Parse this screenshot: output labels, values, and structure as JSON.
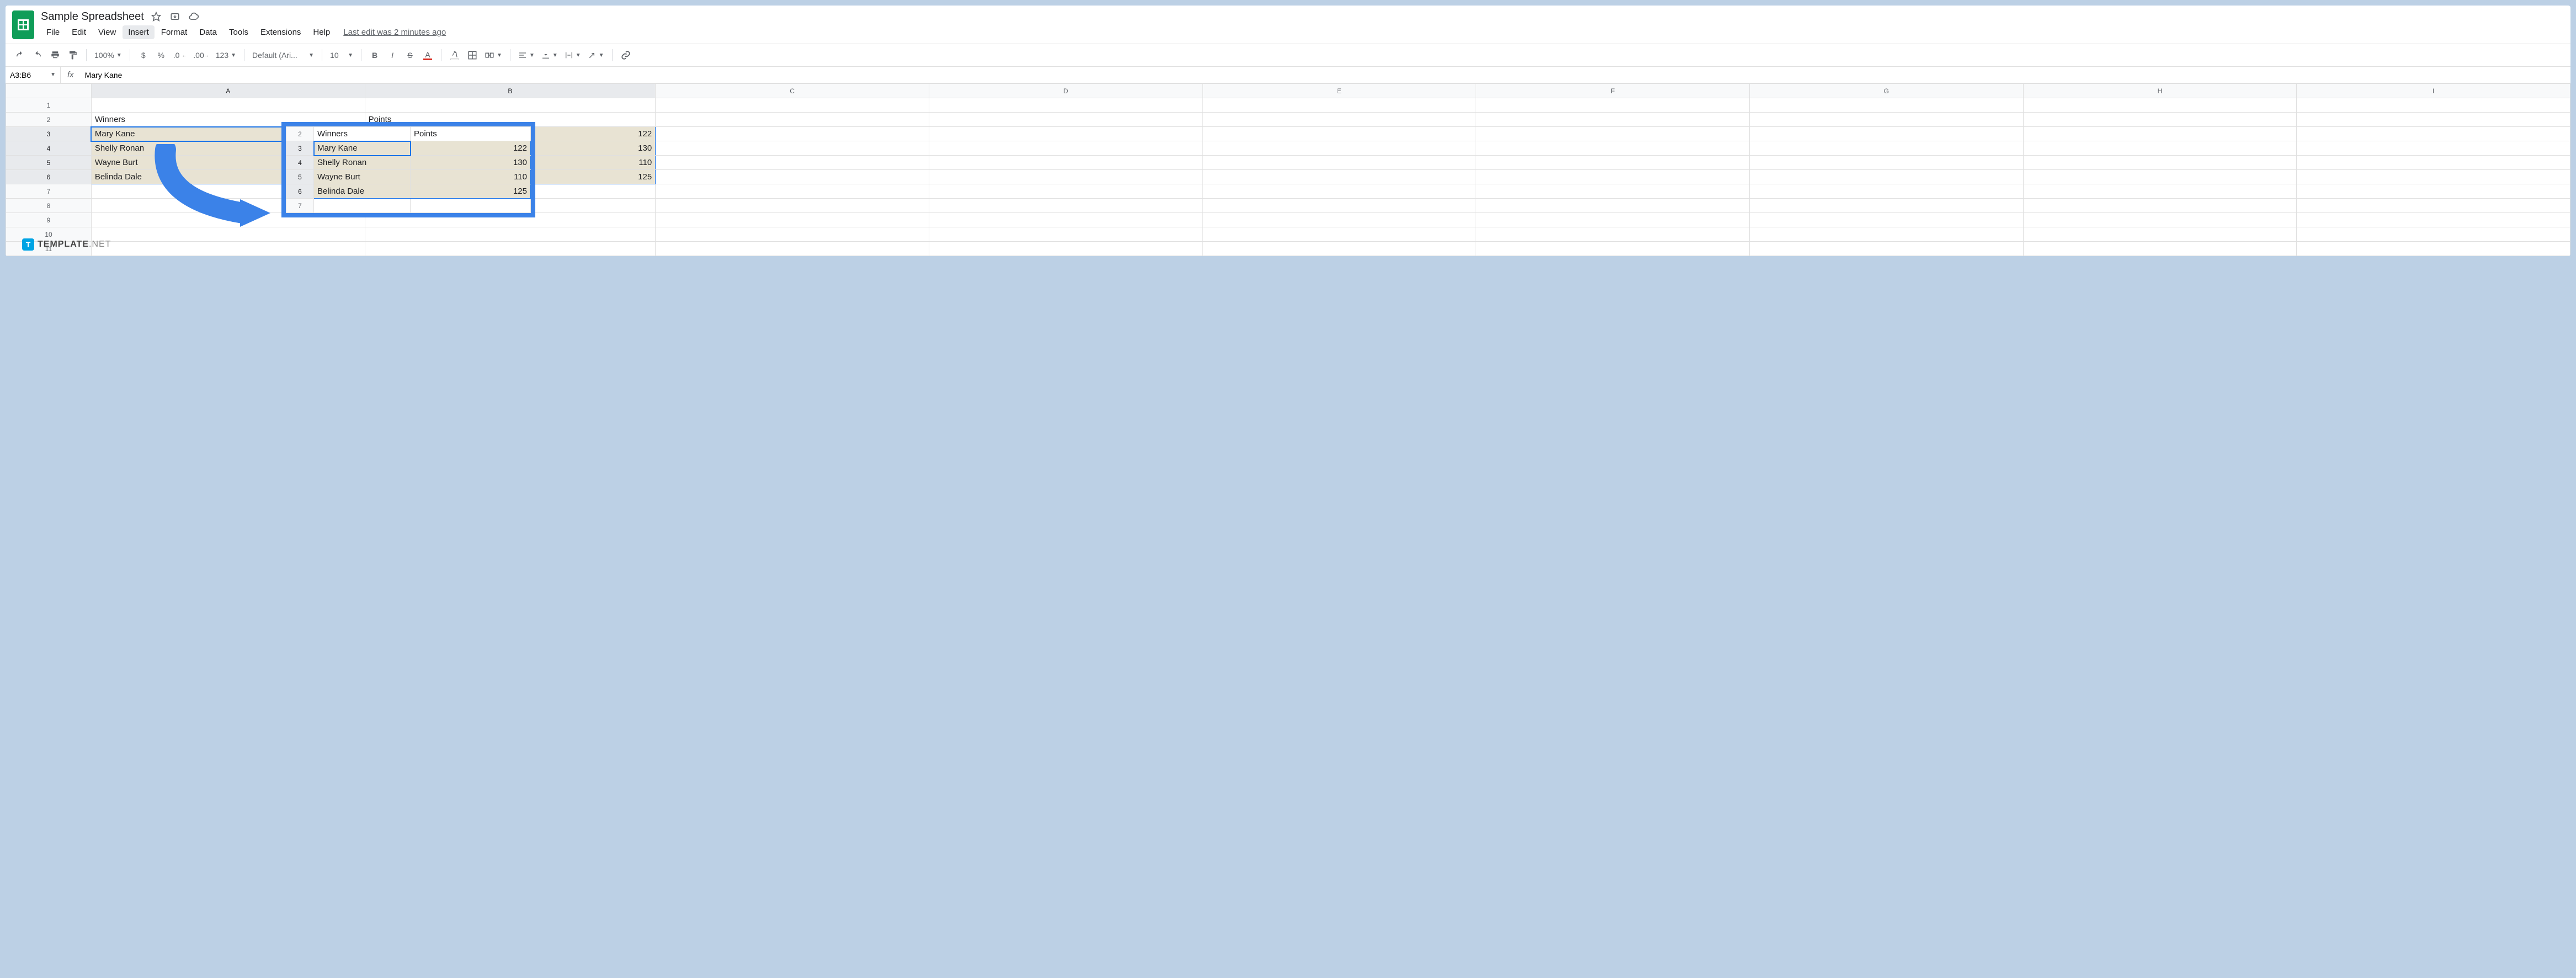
{
  "doc_title": "Sample Spreadsheet",
  "menus": [
    "File",
    "Edit",
    "View",
    "Insert",
    "Format",
    "Data",
    "Tools",
    "Extensions",
    "Help"
  ],
  "active_menu": "Insert",
  "last_edit": "Last edit was 2 minutes ago",
  "toolbar": {
    "zoom": "100%",
    "currency": "$",
    "percent": "%",
    "dec_dec": ".0",
    "inc_dec": ".00",
    "numfmt": "123",
    "font": "Default (Ari...",
    "font_size": "10",
    "text_color": "#000000",
    "text_underline": "#d93025",
    "fill_underline": "#ffffff"
  },
  "namebox": "A3:B6",
  "formula_value": "Mary Kane",
  "columns": [
    "A",
    "B",
    "C",
    "D",
    "E",
    "F",
    "G",
    "H",
    "I"
  ],
  "rows": [
    "1",
    "2",
    "3",
    "4",
    "5",
    "6",
    "7",
    "8",
    "9",
    "10",
    "11"
  ],
  "sheet_data": {
    "headers": {
      "a": "Winners",
      "b": "Points"
    },
    "rows": [
      {
        "a": "Mary Kane",
        "b": "122"
      },
      {
        "a": "Shelly Ronan",
        "b": "130"
      },
      {
        "a": "Wayne Burt",
        "b": "110"
      },
      {
        "a": "Belinda Dale",
        "b": "125"
      }
    ]
  },
  "overlay": {
    "row_nums": [
      "2",
      "3",
      "4",
      "5",
      "6",
      "7"
    ],
    "headers": {
      "a": "Winners",
      "b": "Points"
    },
    "rows": [
      {
        "a": "Mary Kane",
        "b": "122"
      },
      {
        "a": "Shelly Ronan",
        "b": "130"
      },
      {
        "a": "Wayne Burt",
        "b": "110"
      },
      {
        "a": "Belinda Dale",
        "b": "125"
      }
    ]
  },
  "watermark": {
    "brand": "TEMPLATE",
    "tld": ".NET"
  },
  "chart_data": {
    "type": "table",
    "title": "Sample Spreadsheet",
    "columns": [
      "Winners",
      "Points"
    ],
    "rows": [
      [
        "Mary Kane",
        122
      ],
      [
        "Shelly Ronan",
        130
      ],
      [
        "Wayne Burt",
        110
      ],
      [
        "Belinda Dale",
        125
      ]
    ]
  }
}
